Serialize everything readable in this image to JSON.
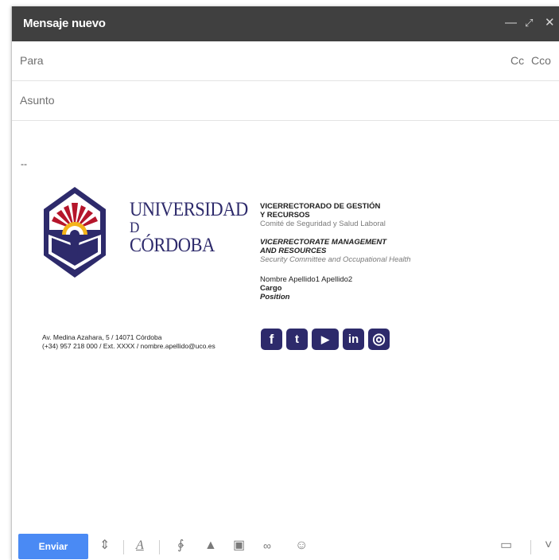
{
  "window": {
    "title": "Mensaje nuevo",
    "controls": [
      "minimize-icon",
      "expand-icon",
      "close-icon"
    ]
  },
  "fields": {
    "to_label": "Para",
    "cc_label": "Cc",
    "bcc_label": "Cco",
    "subject_label": "Asunto"
  },
  "signature": {
    "dash": "--",
    "university": {
      "line1": "UNIVERSIDAD",
      "line2": "D",
      "line3": "CÓRDOBA"
    },
    "vice_es": {
      "line1": "VICERRECTORADO DE GESTIÓN",
      "line2": "Y RECURSOS",
      "dept": "Comité de Seguridad y Salud Laboral"
    },
    "vice_en": {
      "line1": "VICERRECTORATE MANAGEMENT",
      "line2": "AND RESOURCES",
      "dept": "Security Committee and Occupational Health"
    },
    "person": {
      "name": "Nombre Apellido1 Apellido2",
      "cargo": "Cargo",
      "position": "Position"
    },
    "address": {
      "line1": "Av. Medina Azahara, 5 / 14071 Córdoba",
      "line2": "(+34) 957 218 000 / Ext. XXXX / nombre.apellido@uco.es"
    },
    "social": [
      {
        "icon": "facebook-icon",
        "glyph": "f"
      },
      {
        "icon": "twitter-icon",
        "glyph": "t"
      },
      {
        "icon": "youtube-icon",
        "glyph": "▶"
      },
      {
        "icon": "linkedin-icon",
        "glyph": "in"
      },
      {
        "icon": "instagram-icon",
        "glyph": "◎"
      }
    ],
    "brand_color": "#2d2a6b"
  },
  "toolbar": {
    "send_label": "Enviar",
    "send_color": "#4a8af4",
    "tools": [
      "format-icon",
      "attach-icon",
      "drive-icon",
      "photo-icon",
      "link-icon",
      "emoji-icon"
    ],
    "right": [
      "trash-icon",
      "more-options-icon"
    ]
  }
}
